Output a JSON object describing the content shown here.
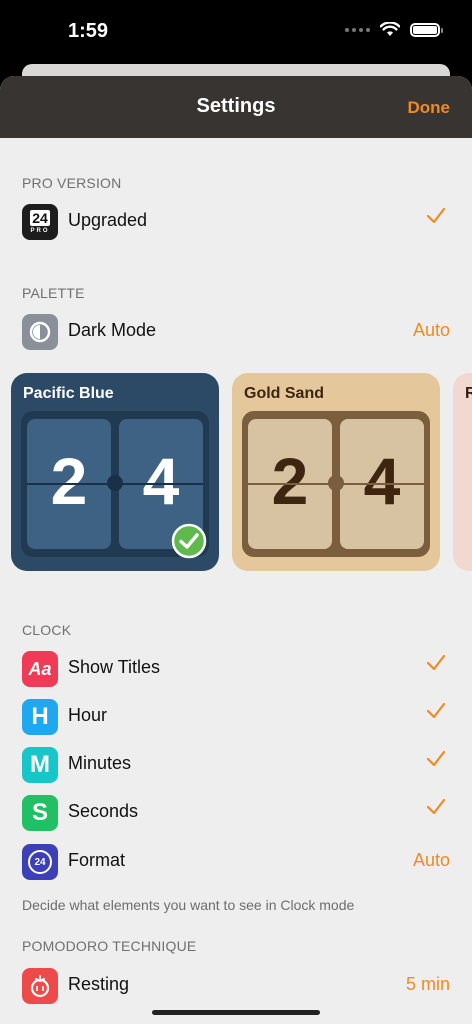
{
  "status": {
    "time": "1:59"
  },
  "nav": {
    "title": "Settings",
    "done_label": "Done"
  },
  "sections": {
    "pro": {
      "header": "PRO VERSION",
      "row": {
        "label": "Upgraded",
        "icon_text": "24",
        "icon_sub": "PRO",
        "checked": true
      }
    },
    "palette": {
      "header": "PALETTE",
      "dark_mode": {
        "label": "Dark Mode",
        "value": "Auto"
      },
      "cards": [
        {
          "name": "Pacific Blue",
          "digits": [
            "2",
            "4"
          ],
          "selected": true,
          "colors": {
            "bg": "#2c4a66",
            "frame": "#203a52",
            "tile": "#3e6283",
            "digit": "#ffffff"
          }
        },
        {
          "name": "Gold Sand",
          "digits": [
            "2",
            "4"
          ],
          "selected": false,
          "colors": {
            "bg": "#e4c79b",
            "frame": "#7a5e3e",
            "tile": "#d7c2a1",
            "digit": "#3e2510"
          }
        },
        {
          "name": "R",
          "digits": [],
          "selected": false,
          "colors": {
            "bg": "#f1d8d0"
          }
        }
      ]
    },
    "clock": {
      "header": "CLOCK",
      "rows": [
        {
          "label": "Show Titles",
          "icon_text": "Aa",
          "icon_color": "#ef3b56",
          "checked": true
        },
        {
          "label": "Hour",
          "icon_text": "H",
          "icon_color": "#1fa8f0",
          "checked": true
        },
        {
          "label": "Minutes",
          "icon_text": "M",
          "icon_color": "#16c6c9",
          "checked": true
        },
        {
          "label": "Seconds",
          "icon_text": "S",
          "icon_color": "#22c064",
          "checked": true
        },
        {
          "label": "Format",
          "icon_text": "24",
          "icon_color": "#3d3fb8",
          "value": "Auto"
        }
      ],
      "footer": "Decide what elements you want to see in Clock mode"
    },
    "pomodoro": {
      "header": "POMODORO TECHNIQUE",
      "rows": [
        {
          "label": "Resting",
          "value": "5 min",
          "icon_color": "#ef4a4a"
        }
      ]
    }
  },
  "accent_color": "#f08a22"
}
